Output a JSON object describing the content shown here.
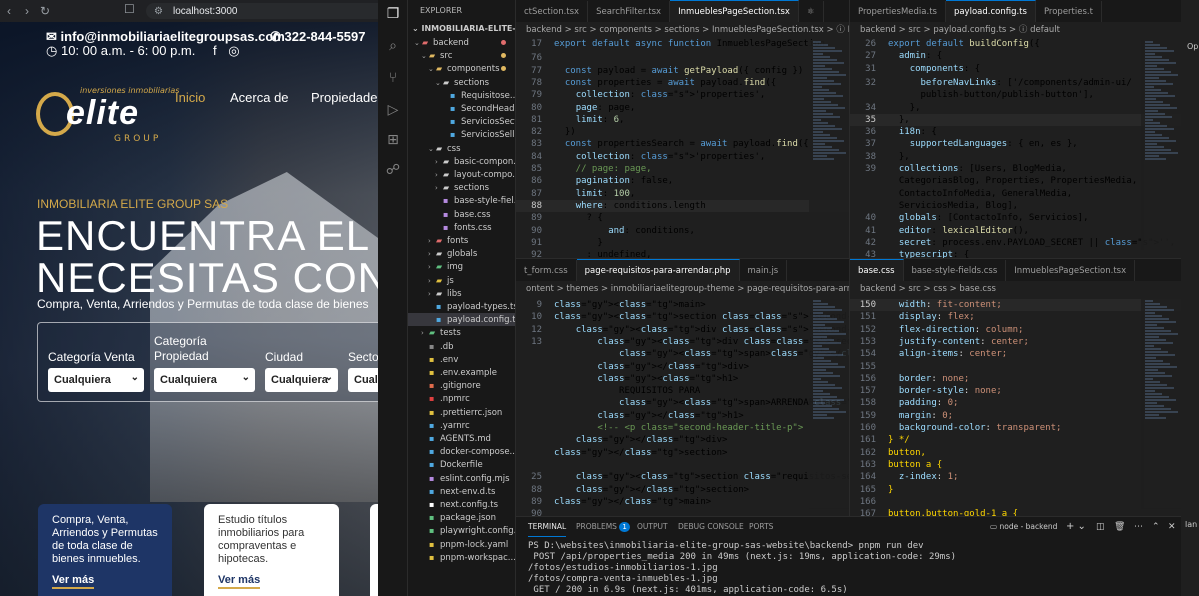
{
  "browser": {
    "url": "localhost:3000",
    "nav_icons": [
      "back-icon",
      "forward-icon",
      "reload-icon"
    ],
    "site": {
      "email": "info@inmobiliariaelitegroupsas.com",
      "phone": "322-844-5597",
      "hours": "10: 00 a.m. - 6: 00 p.m.",
      "logo": {
        "tagline": "inversiones inmobiliarias",
        "name": "elite",
        "group": "GROUP"
      },
      "nav": [
        "Inicio",
        "Acerca de",
        "Propiedades"
      ],
      "eyebrow": "INMOBILIARIA ELITE GROUP SAS",
      "hero_line1_a": "ENCUENTRA EL ",
      "hero_line1_b": "IN",
      "hero_line2": "NECESITAS CON M",
      "subtitle": "Compra, Venta, Arriendos y Permutas de toda clase de bienes",
      "filters": [
        {
          "label": "Categoría Venta",
          "value": "Cualquiera"
        },
        {
          "label": "Categoría Propiedad",
          "value": "Cualquiera"
        },
        {
          "label": "Ciudad",
          "value": "Cualquiera"
        },
        {
          "label": "Secto",
          "value": "Cualquiera"
        }
      ],
      "card1": {
        "text": "Compra, Venta, Arriendos y Permutas de toda clase de bienes inmuebles.",
        "more": "Ver más"
      },
      "card2": {
        "text": "Estudio títulos inmobiliarios para compraventas e hipotecas.",
        "more": "Ver más"
      }
    }
  },
  "explorer": {
    "title": "EXPLORER",
    "root": "INMOBILIARIA-ELITE-GRO...",
    "rows": [
      {
        "name": "backend",
        "depth": 0,
        "kind": "folder-open",
        "color": "#e06c6c"
      },
      {
        "name": "src",
        "depth": 1,
        "kind": "folder-open",
        "color": "#e0b860"
      },
      {
        "name": "components",
        "depth": 2,
        "kind": "folder-open",
        "color": "#e0b860"
      },
      {
        "name": "sections",
        "depth": 3,
        "kind": "folder-open",
        "color": "#cccccc"
      },
      {
        "name": "Requisitose...",
        "depth": 4,
        "kind": "file",
        "color": "#4fa8e0"
      },
      {
        "name": "SecondHead...",
        "depth": 4,
        "kind": "file",
        "color": "#4fa8e0"
      },
      {
        "name": "ServiciosSect...",
        "depth": 4,
        "kind": "file",
        "color": "#4fa8e0"
      },
      {
        "name": "ServiciosSelli...",
        "depth": 4,
        "kind": "file",
        "color": "#4fa8e0"
      },
      {
        "name": "css",
        "depth": 2,
        "kind": "folder-open",
        "color": "#cccccc"
      },
      {
        "name": "basic-compon...",
        "depth": 3,
        "kind": "folder",
        "color": "#cccccc"
      },
      {
        "name": "layout-compo...",
        "depth": 3,
        "kind": "folder",
        "color": "#cccccc"
      },
      {
        "name": "sections",
        "depth": 3,
        "kind": "folder",
        "color": "#cccccc"
      },
      {
        "name": "base-style-fiel...",
        "depth": 3,
        "kind": "file",
        "color": "#b58ae0"
      },
      {
        "name": "base.css",
        "depth": 3,
        "kind": "file",
        "color": "#b58ae0"
      },
      {
        "name": "fonts.css",
        "depth": 3,
        "kind": "file",
        "color": "#b58ae0"
      },
      {
        "name": "fonts",
        "depth": 2,
        "kind": "folder",
        "color": "#e06c6c"
      },
      {
        "name": "globals",
        "depth": 2,
        "kind": "folder",
        "color": "#cccccc"
      },
      {
        "name": "img",
        "depth": 2,
        "kind": "folder",
        "color": "#60c080"
      },
      {
        "name": "js",
        "depth": 2,
        "kind": "folder",
        "color": "#e0c040"
      },
      {
        "name": "libs",
        "depth": 2,
        "kind": "folder",
        "color": "#cccccc"
      },
      {
        "name": "payload-types.ts",
        "depth": 2,
        "kind": "file",
        "color": "#4fa8e0"
      },
      {
        "name": "payload.config.ts",
        "depth": 2,
        "kind": "file",
        "color": "#4fa8e0",
        "selected": true
      },
      {
        "name": "tests",
        "depth": 1,
        "kind": "folder",
        "color": "#60c080"
      },
      {
        "name": ".db",
        "depth": 1,
        "kind": "file",
        "color": "#888888"
      },
      {
        "name": ".env",
        "depth": 1,
        "kind": "file",
        "color": "#e0c040"
      },
      {
        "name": ".env.example",
        "depth": 1,
        "kind": "file",
        "color": "#e0c040"
      },
      {
        "name": ".gitignore",
        "depth": 1,
        "kind": "file",
        "color": "#e06c4c"
      },
      {
        "name": ".npmrc",
        "depth": 1,
        "kind": "file",
        "color": "#e04040"
      },
      {
        "name": ".prettierrc.json",
        "depth": 1,
        "kind": "file",
        "color": "#e0c040"
      },
      {
        "name": ".yarnrc",
        "depth": 1,
        "kind": "file",
        "color": "#4fa8e0"
      },
      {
        "name": "AGENTS.md",
        "depth": 1,
        "kind": "file",
        "color": "#4fa8e0"
      },
      {
        "name": "docker-compose....",
        "depth": 1,
        "kind": "file",
        "color": "#4fa8e0"
      },
      {
        "name": "Dockerfile",
        "depth": 1,
        "kind": "file",
        "color": "#4fa8e0"
      },
      {
        "name": "eslint.config.mjs",
        "depth": 1,
        "kind": "file",
        "color": "#b58ae0"
      },
      {
        "name": "next-env.d.ts",
        "depth": 1,
        "kind": "file",
        "color": "#4fa8e0"
      },
      {
        "name": "next.config.ts",
        "depth": 1,
        "kind": "file",
        "color": "#ffffff"
      },
      {
        "name": "package.json",
        "depth": 1,
        "kind": "file",
        "color": "#60c080"
      },
      {
        "name": "playwright.config...",
        "depth": 1,
        "kind": "file",
        "color": "#60c080"
      },
      {
        "name": "pnpm-lock.yaml",
        "depth": 1,
        "kind": "file",
        "color": "#e0c040"
      },
      {
        "name": "pnpm-workspac...",
        "depth": 1,
        "kind": "file",
        "color": "#e0c040"
      }
    ]
  },
  "editor_top_left": {
    "tabs": [
      "ctSection.tsx",
      "SearchFilter.tsx",
      "InmueblesPageSection.tsx",
      "⚛"
    ],
    "active_tab": 2,
    "breadcrumb": "backend > src > components > sections > InmueblesPageSection.tsx > ⓘ Inmuebles",
    "sticky": [
      {
        "n": "17",
        "code": "export default async function InmueblesPageSection"
      }
    ],
    "lines": [
      {
        "n": "76",
        "code": ""
      },
      {
        "n": "77",
        "code": "  const payload = await getPayload({ config })"
      },
      {
        "n": "78",
        "code": "  const properties = await payload.find({"
      },
      {
        "n": "79",
        "code": "    collection: 'properties',"
      },
      {
        "n": "80",
        "code": "    page: page,"
      },
      {
        "n": "81",
        "code": "    limit: 6,"
      },
      {
        "n": "82",
        "code": "  })"
      },
      {
        "n": "83",
        "code": "  const propertiesSearch = await payload.find({"
      },
      {
        "n": "84",
        "code": "    collection: 'properties',"
      },
      {
        "n": "85",
        "code": "    // page: page,"
      },
      {
        "n": "86",
        "code": "    pagination: false,"
      },
      {
        "n": "87",
        "code": "    limit: 100,"
      },
      {
        "n": "88",
        "code": "    where: conditions.length"
      },
      {
        "n": "89",
        "code": "      ? {"
      },
      {
        "n": "90",
        "code": "          and: conditions,"
      },
      {
        "n": "91",
        "code": "        }"
      },
      {
        "n": "92",
        "code": "      : undefined,"
      }
    ]
  },
  "editor_top_right": {
    "tabs": [
      "PropertiesMedia.ts",
      "payload.config.ts",
      "Properties.t"
    ],
    "active_tab": 1,
    "breadcrumb": "backend > src > payload.config.ts > ⓘ default",
    "sticky": [
      {
        "n": "26",
        "code": "export default buildConfig({"
      },
      {
        "n": "27",
        "code": "  admin: {"
      },
      {
        "n": "31",
        "code": "    components: {"
      }
    ],
    "lines": [
      {
        "n": "32",
        "code": "      beforeNavLinks: ['/components/admin-ui/"
      },
      {
        "n": "",
        "code": "      publish-button/publish-button'],"
      },
      {
        "n": "34",
        "code": "    },"
      },
      {
        "n": "35",
        "code": "  },"
      },
      {
        "n": "36",
        "code": "  i18n: {"
      },
      {
        "n": "37",
        "code": "    supportedLanguages: { en, es },"
      },
      {
        "n": "38",
        "code": "  },"
      },
      {
        "n": "39",
        "code": "  collections: [Users, BlogMedia,"
      },
      {
        "n": "",
        "code": "  CategoriasBlog, Properties, PropertiesMedia,"
      },
      {
        "n": "",
        "code": "  ContactoInfoMedia, GeneralMedia,"
      },
      {
        "n": "",
        "code": "  ServiciosMedia, Blog],"
      },
      {
        "n": "40",
        "code": "  globals: [ContactoInfo, Servicios],"
      },
      {
        "n": "41",
        "code": "  editor: lexicalEditor(),"
      },
      {
        "n": "42",
        "code": "  secret: process.env.PAYLOAD_SECRET || '',"
      },
      {
        "n": "43",
        "code": "  typescript: {"
      }
    ]
  },
  "editor_bottom_left": {
    "tabs": [
      "t_form.css",
      "page-requisitos-para-arrendar.php",
      "main.js"
    ],
    "active_tab": 1,
    "breadcrumb": "ontent > themes > inmobiliariaelitegroup-theme > page-requisitos-para-arrendar.php",
    "lines": [
      {
        "n": "9",
        "code": "<main>"
      },
      {
        "n": "10",
        "code": "<section class=\"second-header\" style=\"background-i"
      },
      {
        "n": "12",
        "code": "    <div class=\"second-header-box\">"
      },
      {
        "n": "13",
        "code": "        <div class=\"second-header-title-tag\">"
      },
      {
        "n": "",
        "code": "            <span></span>"
      },
      {
        "n": "",
        "code": "        </div>"
      },
      {
        "n": "",
        "code": "        <h1>"
      },
      {
        "n": "",
        "code": "            REQUISITOS PARA"
      },
      {
        "n": "",
        "code": "            <span>ARRENDAR</span>"
      },
      {
        "n": "",
        "code": "        </h1>"
      },
      {
        "n": "",
        "code": "        <!-- <p class=\"second-header-title-p\">"
      },
      {
        "n": "",
        "code": "    </div>"
      },
      {
        "n": "",
        "code": "</section>"
      },
      {
        "n": "",
        "code": ""
      },
      {
        "n": "25",
        "code": "    <section class=\"requisitos-section base-style-"
      },
      {
        "n": "88",
        "code": "    </section>"
      },
      {
        "n": "89",
        "code": "</main>"
      },
      {
        "n": "90",
        "code": ""
      },
      {
        "n": "91",
        "code": "<?php"
      }
    ]
  },
  "editor_bottom_right": {
    "tabs": [
      "base.css",
      "base-style-fields.css",
      "InmueblesPageSection.tsx"
    ],
    "active_tab": 0,
    "breadcrumb": "backend > src > css > base.css",
    "lines": [
      {
        "n": "150",
        "code": "  width: fit-content;"
      },
      {
        "n": "151",
        "code": "  display: flex;"
      },
      {
        "n": "152",
        "code": "  flex-direction: column;"
      },
      {
        "n": "153",
        "code": "  justify-content: center;"
      },
      {
        "n": "154",
        "code": "  align-items: center;"
      },
      {
        "n": "155",
        "code": ""
      },
      {
        "n": "156",
        "code": "  border: none;"
      },
      {
        "n": "157",
        "code": "  border-style: none;"
      },
      {
        "n": "158",
        "code": "  padding: 0;"
      },
      {
        "n": "159",
        "code": "  margin: 0;"
      },
      {
        "n": "160",
        "code": "  background-color: transparent;"
      },
      {
        "n": "161",
        "code": "} */"
      },
      {
        "n": "162",
        "code": "button,"
      },
      {
        "n": "163",
        "code": "button a {"
      },
      {
        "n": "164",
        "code": "  z-index: 1;"
      },
      {
        "n": "165",
        "code": "}"
      },
      {
        "n": "166",
        "code": ""
      },
      {
        "n": "167",
        "code": "button.button-gold-1 a {"
      }
    ]
  },
  "terminal": {
    "tabs": [
      "TERMINAL",
      "PROBLEMS",
      "OUTPUT",
      "DEBUG CONSOLE",
      "PORTS"
    ],
    "problems_count": "1",
    "shell": "node - backend",
    "lines": [
      "PS D:\\websites\\inmobiliaria-elite-group-sas-website\\backend> pnpm run dev",
      " POST /api/properties_media 200 in 49ms (next.js: 19ms, application-code: 29ms)",
      "/fotos/estudios-inmobiliarios-1.jpg",
      "/fotos/compra-venta-inmuebles-1.jpg",
      " GET / 200 in 6.9s (next.js: 401ms, application-code: 6.5s)"
    ]
  },
  "right_edge": {
    "texts": [
      "Op",
      "lan"
    ]
  }
}
